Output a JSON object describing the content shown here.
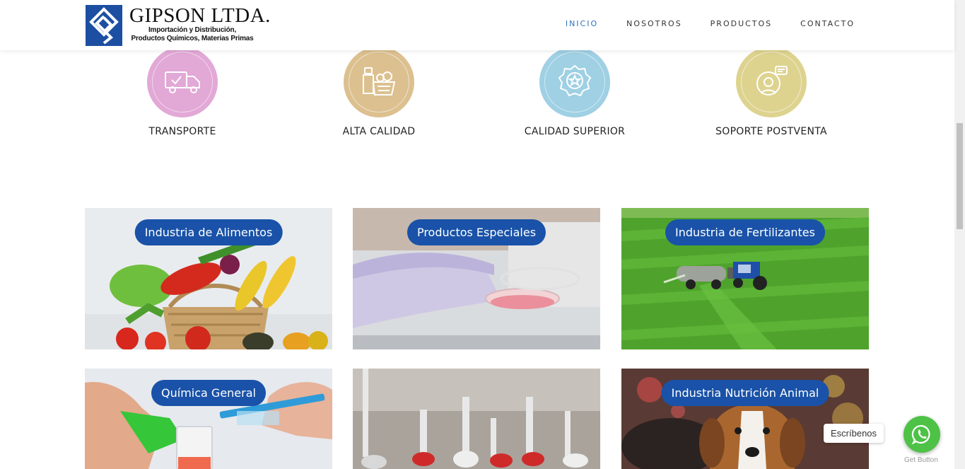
{
  "header": {
    "logo_title": "GIPSON LTDA.",
    "logo_sub_1": "Importación y Distribución,",
    "logo_sub_2": "Productos Químicos, Materias Primas",
    "nav": [
      "INICIO",
      "NOSOTROS",
      "PRODUCTOS",
      "CONTACTO"
    ],
    "active_nav": "INICIO"
  },
  "features": [
    {
      "label": "TRANSPORTE",
      "icon": "truck-icon",
      "color": "#e2a8d6"
    },
    {
      "label": "ALTA CALIDAD",
      "icon": "food-basket-icon",
      "color": "#dcc08f"
    },
    {
      "label": "CALIDAD SUPERIOR",
      "icon": "quality-badge-icon",
      "color": "#9fd0e4"
    },
    {
      "label": "SOPORTE POSTVENTA",
      "icon": "support-headset-icon",
      "color": "#ddd38f"
    }
  ],
  "categories": [
    {
      "label": "Industria de Alimentos"
    },
    {
      "label": "Productos Especiales"
    },
    {
      "label": "Industria de Fertilizantes"
    },
    {
      "label": "Química General"
    },
    {
      "label": "Industria Nutrición Animal"
    }
  ],
  "whatsapp": {
    "bubble_text": "Escríbenos",
    "get_button": "Get Button",
    "color": "#4dc247"
  },
  "colors": {
    "accent": "#1952a8",
    "nav_active": "#2f72b8"
  }
}
